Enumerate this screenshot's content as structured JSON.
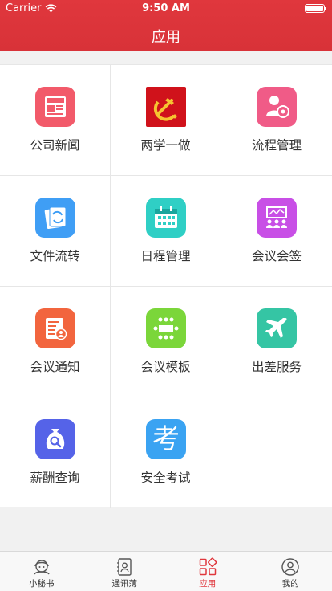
{
  "status_bar": {
    "carrier": "Carrier",
    "time": "9:50 AM"
  },
  "header": {
    "title": "应用"
  },
  "apps": [
    {
      "label": "公司新闻",
      "icon": "news-icon",
      "color": "#f25a6a"
    },
    {
      "label": "两学一做",
      "icon": "party-emblem-icon",
      "color": "#d0121b"
    },
    {
      "label": "流程管理",
      "icon": "workflow-icon",
      "color": "#f05b87"
    },
    {
      "label": "文件流转",
      "icon": "file-transfer-icon",
      "color": "#3f9ef5"
    },
    {
      "label": "日程管理",
      "icon": "calendar-icon",
      "color": "#2fcfc5"
    },
    {
      "label": "会议会签",
      "icon": "meeting-sign-icon",
      "color": "#c84fe6"
    },
    {
      "label": "会议通知",
      "icon": "meeting-notice-icon",
      "color": "#f2653e"
    },
    {
      "label": "会议模板",
      "icon": "meeting-template-icon",
      "color": "#7bd63a"
    },
    {
      "label": "出差服务",
      "icon": "airplane-icon",
      "color": "#35c5a4"
    },
    {
      "label": "薪酬查询",
      "icon": "salary-search-icon",
      "color": "#5563e8"
    },
    {
      "label": "安全考试",
      "icon": "exam-icon",
      "color": "#3aa3f2",
      "glyph": "考"
    }
  ],
  "tabbar": {
    "items": [
      {
        "label": "小秘书",
        "icon": "assistant-icon",
        "active": false
      },
      {
        "label": "通讯薄",
        "icon": "contacts-icon",
        "active": false
      },
      {
        "label": "应用",
        "icon": "apps-icon",
        "active": true
      },
      {
        "label": "我的",
        "icon": "profile-icon",
        "active": false
      }
    ]
  }
}
